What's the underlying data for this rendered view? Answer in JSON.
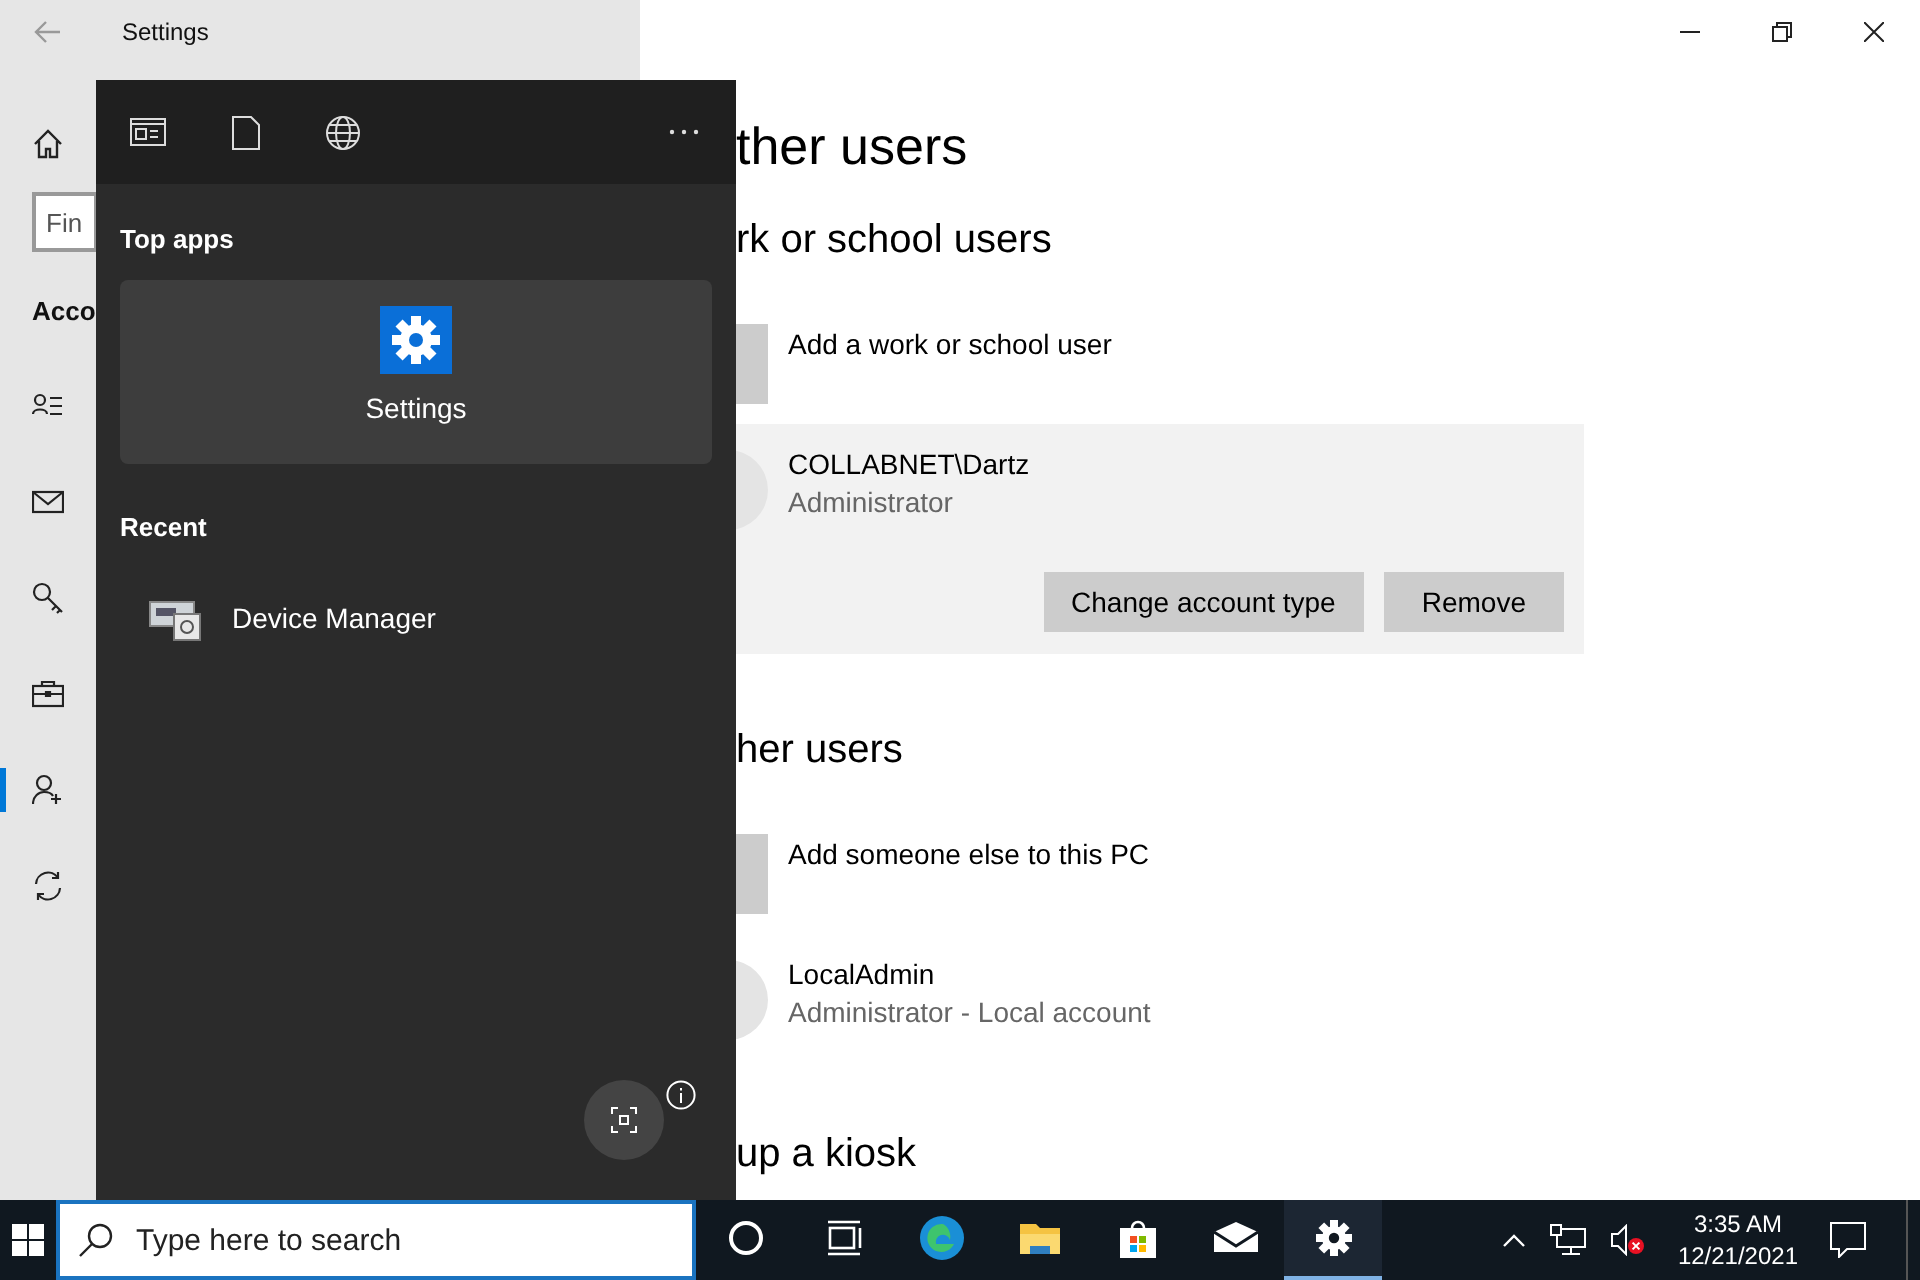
{
  "settings_window": {
    "title": "Settings",
    "search": {
      "placeholder": "Fin"
    },
    "section_heading": "Acco",
    "nav_items": [
      {
        "kind": "info",
        "selected": false
      },
      {
        "kind": "email",
        "selected": false
      },
      {
        "kind": "key",
        "selected": false
      },
      {
        "kind": "work",
        "selected": false
      },
      {
        "kind": "family",
        "selected": true
      },
      {
        "kind": "sync",
        "selected": false
      }
    ],
    "content": {
      "page_title": "ther users",
      "groups": [
        {
          "heading": "rk or school users",
          "add_label": "Add a work or school user",
          "users": [
            {
              "name": "COLLABNET\\Dartz",
              "role": "Administrator",
              "expanded": true,
              "buttons": [
                "Change account type",
                "Remove"
              ]
            }
          ]
        },
        {
          "heading": "her users",
          "add_label": "Add someone else to this PC",
          "users": [
            {
              "name": "LocalAdmin",
              "role": "Administrator - Local account",
              "expanded": false
            }
          ]
        }
      ],
      "kiosk_heading": "up a kiosk"
    }
  },
  "search_flyout": {
    "top_apps_heading": "Top apps",
    "top_app": {
      "label": "Settings"
    },
    "recent_heading": "Recent",
    "recent": [
      {
        "label": "Device Manager"
      }
    ]
  },
  "taskbar": {
    "search": {
      "placeholder": "Type here to search"
    },
    "pinned": [
      {
        "kind": "cortana",
        "active": false
      },
      {
        "kind": "taskview",
        "active": false
      },
      {
        "kind": "browser",
        "active": false
      },
      {
        "kind": "folder",
        "active": false
      },
      {
        "kind": "store",
        "active": false
      },
      {
        "kind": "mail",
        "active": false
      },
      {
        "kind": "settings",
        "active": true
      }
    ],
    "time": "3:35 AM",
    "date": "12/21/2021"
  }
}
